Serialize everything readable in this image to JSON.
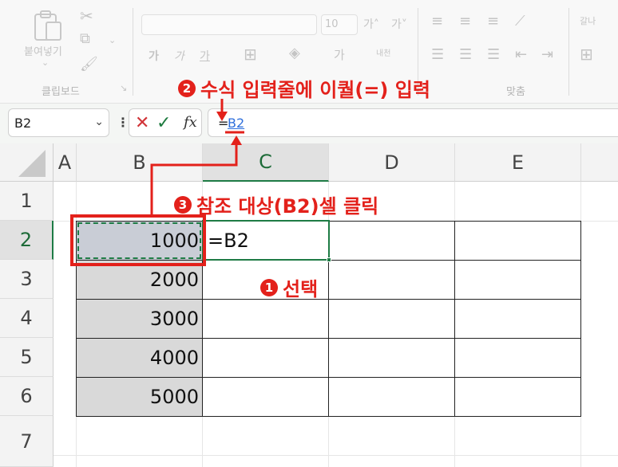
{
  "ribbon": {
    "clipboard": {
      "paste_label": "붙여넣기",
      "group_label": "클립보드"
    },
    "font": {
      "size_value": "10",
      "grow_label": "가˄",
      "shrink_label": "가˅",
      "bold_label": "가",
      "italic_label": "가",
      "underline_label": "가",
      "font_color_label": "가",
      "phonetic_label": "내천"
    },
    "alignment": {
      "group_label": "맞춤",
      "wrap_label": "갈나"
    }
  },
  "formula_bar": {
    "name_box": "B2",
    "fx_label": "fx",
    "formula_equals": "=",
    "formula_ref": "B2"
  },
  "sheet": {
    "columns": [
      "A",
      "B",
      "C",
      "D",
      "E"
    ],
    "rows": [
      "1",
      "2",
      "3",
      "4",
      "5",
      "6",
      "7"
    ],
    "selected_column": "C",
    "selected_row": "2",
    "b_values": [
      "1000",
      "2000",
      "3000",
      "4000",
      "5000"
    ],
    "c2_formula": "=B2"
  },
  "annotations": {
    "step1_num": "1",
    "step1_text": "선택",
    "step2_num": "2",
    "step2_text": "수식 입력줄에 이퀄(=) 입력",
    "step3_num": "3",
    "step3_text": "참조 대상(B2)셀 클릭"
  },
  "colors": {
    "annotation_red": "#e3211b",
    "selection_green": "#1e7b45",
    "reference_blue": "#2f6fdc"
  }
}
